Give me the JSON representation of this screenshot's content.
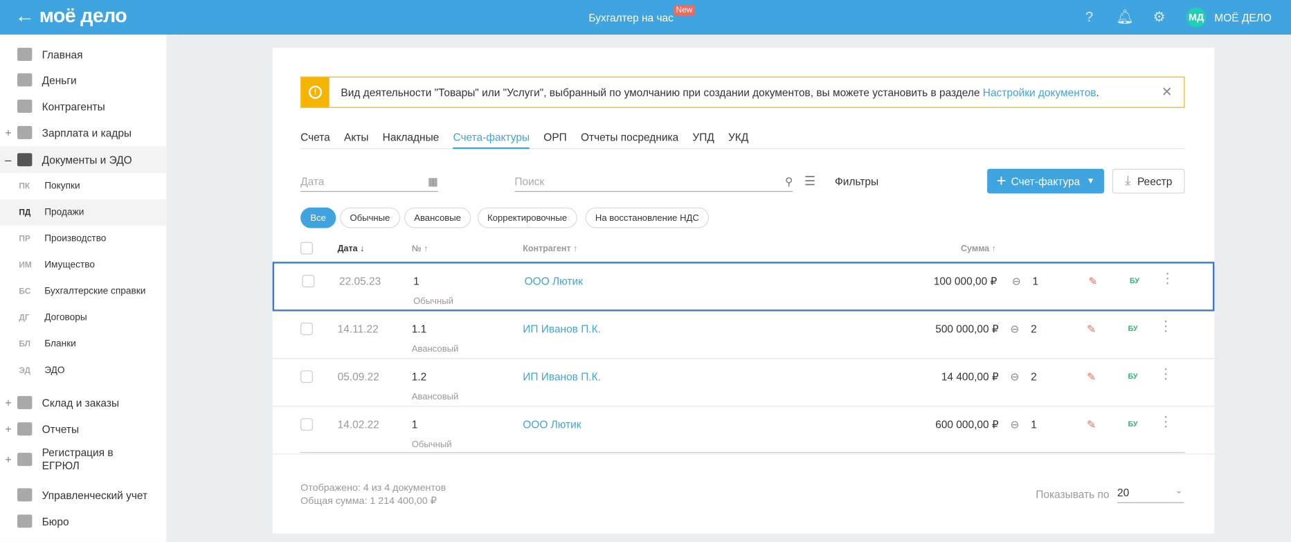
{
  "header": {
    "logo": "моё дело",
    "back_icon": "arrow-left",
    "center_link": "Бухгалтер на час",
    "badge": "New",
    "company": "МОЁ ДЕЛО",
    "avatar": "МД"
  },
  "sidebar": {
    "items": [
      {
        "label": "Главная",
        "pm": ""
      },
      {
        "label": "Деньги",
        "pm": ""
      },
      {
        "label": "Контрагенты",
        "pm": ""
      },
      {
        "label": "Зарплата и кадры",
        "pm": "+"
      },
      {
        "label": "Документы и ЭДО",
        "pm": "–"
      }
    ],
    "sub": [
      {
        "ab": "ПК",
        "label": "Покупки"
      },
      {
        "ab": "ПД",
        "label": "Продажи"
      },
      {
        "ab": "ПР",
        "label": "Производство"
      },
      {
        "ab": "ИМ",
        "label": "Имущество"
      },
      {
        "ab": "БС",
        "label": "Бухгалтерские справки"
      },
      {
        "ab": "ДГ",
        "label": "Договоры"
      },
      {
        "ab": "БЛ",
        "label": "Бланки"
      },
      {
        "ab": "ЭД",
        "label": "ЭДО"
      }
    ],
    "bottom": [
      {
        "label": "Склад и заказы",
        "pm": "+"
      },
      {
        "label": "Отчеты",
        "pm": "+"
      },
      {
        "label": "Регистрация в",
        "label2": "ЕГРЮЛ",
        "pm": "+"
      },
      {
        "label": "Управленческий учет",
        "pm": ""
      },
      {
        "label": "Бюро",
        "pm": ""
      }
    ]
  },
  "banner": {
    "text": "Вид деятельности \"Товары\" или \"Услуги\", выбранный по умолчанию при создании документов, вы можете установить в разделе ",
    "link": "Настройки документов",
    "end": "."
  },
  "tabs": [
    "Счета",
    "Акты",
    "Накладные",
    "Счета-фактуры",
    "ОРП",
    "Отчеты посредника",
    "УПД",
    "УКД"
  ],
  "filters": {
    "date_placeholder": "Дата",
    "search_placeholder": "Поиск",
    "filters_label": "Фильтры",
    "create_button": "Счет-фактура",
    "registry_button": "Реестр"
  },
  "chips": [
    "Все",
    "Обычные",
    "Авансовые",
    "Корректировочные",
    "На восстановление НДС"
  ],
  "table": {
    "headers": {
      "date": "Дата ↓",
      "num": "№ ↑",
      "contractor": "Контрагент ↑",
      "sum": "Сумма ↑"
    },
    "rows": [
      {
        "date": "22.05.23",
        "num": "1",
        "type": "Обычный",
        "contractor": "ООО Лютик",
        "sum": "100 000,00 ₽",
        "links": "1",
        "bu": "БУ"
      },
      {
        "date": "14.11.22",
        "num": "1.1",
        "type": "Авансовый",
        "contractor": "ИП Иванов П.К.",
        "sum": "500 000,00 ₽",
        "links": "2",
        "bu": "БУ"
      },
      {
        "date": "05.09.22",
        "num": "1.2",
        "type": "Авансовый",
        "contractor": "ИП Иванов П.К.",
        "sum": "14 400,00 ₽",
        "links": "2",
        "bu": "БУ"
      },
      {
        "date": "14.02.22",
        "num": "1",
        "type": "Обычный",
        "contractor": "ООО Лютик",
        "sum": "600 000,00 ₽",
        "links": "1",
        "bu": "БУ"
      }
    ]
  },
  "footer": {
    "shown": "Отображено: 4 из 4 документов",
    "total": "Общая сумма: 1 214 400,00 ₽",
    "per_page_label": "Показывать по",
    "per_page": "20"
  }
}
